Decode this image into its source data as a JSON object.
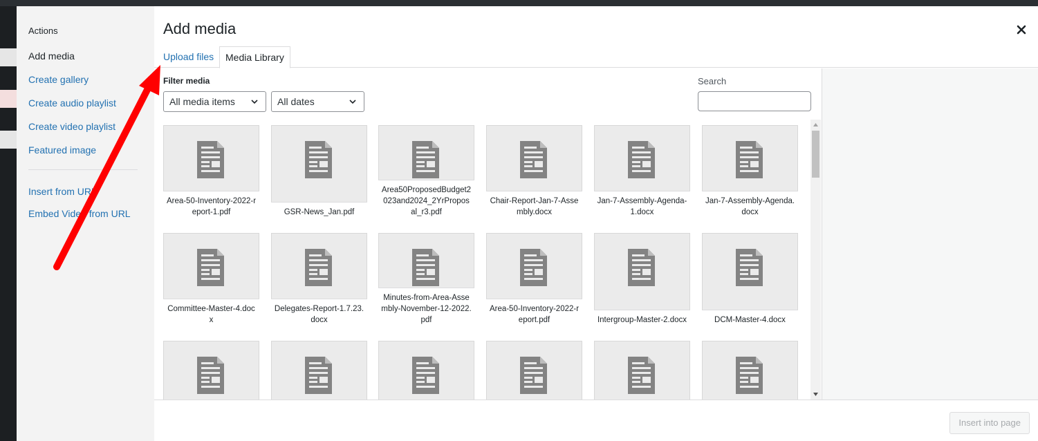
{
  "sidebar": {
    "heading": "Actions",
    "items": [
      {
        "label": "Add media",
        "active": true
      },
      {
        "label": "Create gallery"
      },
      {
        "label": "Create audio playlist"
      },
      {
        "label": "Create video playlist"
      },
      {
        "label": "Featured image"
      },
      {
        "label": "Insert from URL"
      },
      {
        "label": "Embed Video from URL"
      }
    ]
  },
  "modal": {
    "title": "Add media",
    "close_icon": "close-icon"
  },
  "tabs": [
    {
      "label": "Upload files"
    },
    {
      "label": "Media Library",
      "active": true
    }
  ],
  "filters": {
    "label": "Filter media",
    "type_value": "All media items",
    "date_value": "All dates",
    "search_label": "Search",
    "search_value": ""
  },
  "media": [
    {
      "name": "Area-50-Inventory-2022-report-1.pdf"
    },
    {
      "name": "GSR-News_Jan.pdf"
    },
    {
      "name": "Area50ProposedBudget2023and2024_2YrProposal_r3.pdf"
    },
    {
      "name": "Chair-Report-Jan-7-Assembly.docx"
    },
    {
      "name": "Jan-7-Assembly-Agenda-1.docx"
    },
    {
      "name": "Jan-7-Assembly-Agenda.docx"
    },
    {
      "name": "Committee-Master-4.docx"
    },
    {
      "name": "Delegates-Report-1.7.23.docx"
    },
    {
      "name": "Minutes-from-Area-Assembly-November-12-2022.pdf"
    },
    {
      "name": "Area-50-Inventory-2022-report.pdf"
    },
    {
      "name": "Intergroup-Master-2.docx"
    },
    {
      "name": "DCM-Master-4.docx"
    },
    {
      "name": ""
    },
    {
      "name": ""
    },
    {
      "name": ""
    },
    {
      "name": ""
    },
    {
      "name": ""
    },
    {
      "name": ""
    }
  ],
  "footer": {
    "insert_label": "Insert into page"
  },
  "annotation": {
    "arrow_color": "#ff0000"
  },
  "colors": {
    "link": "#2271b1",
    "sidebar_bg": "#f3f3f3"
  }
}
